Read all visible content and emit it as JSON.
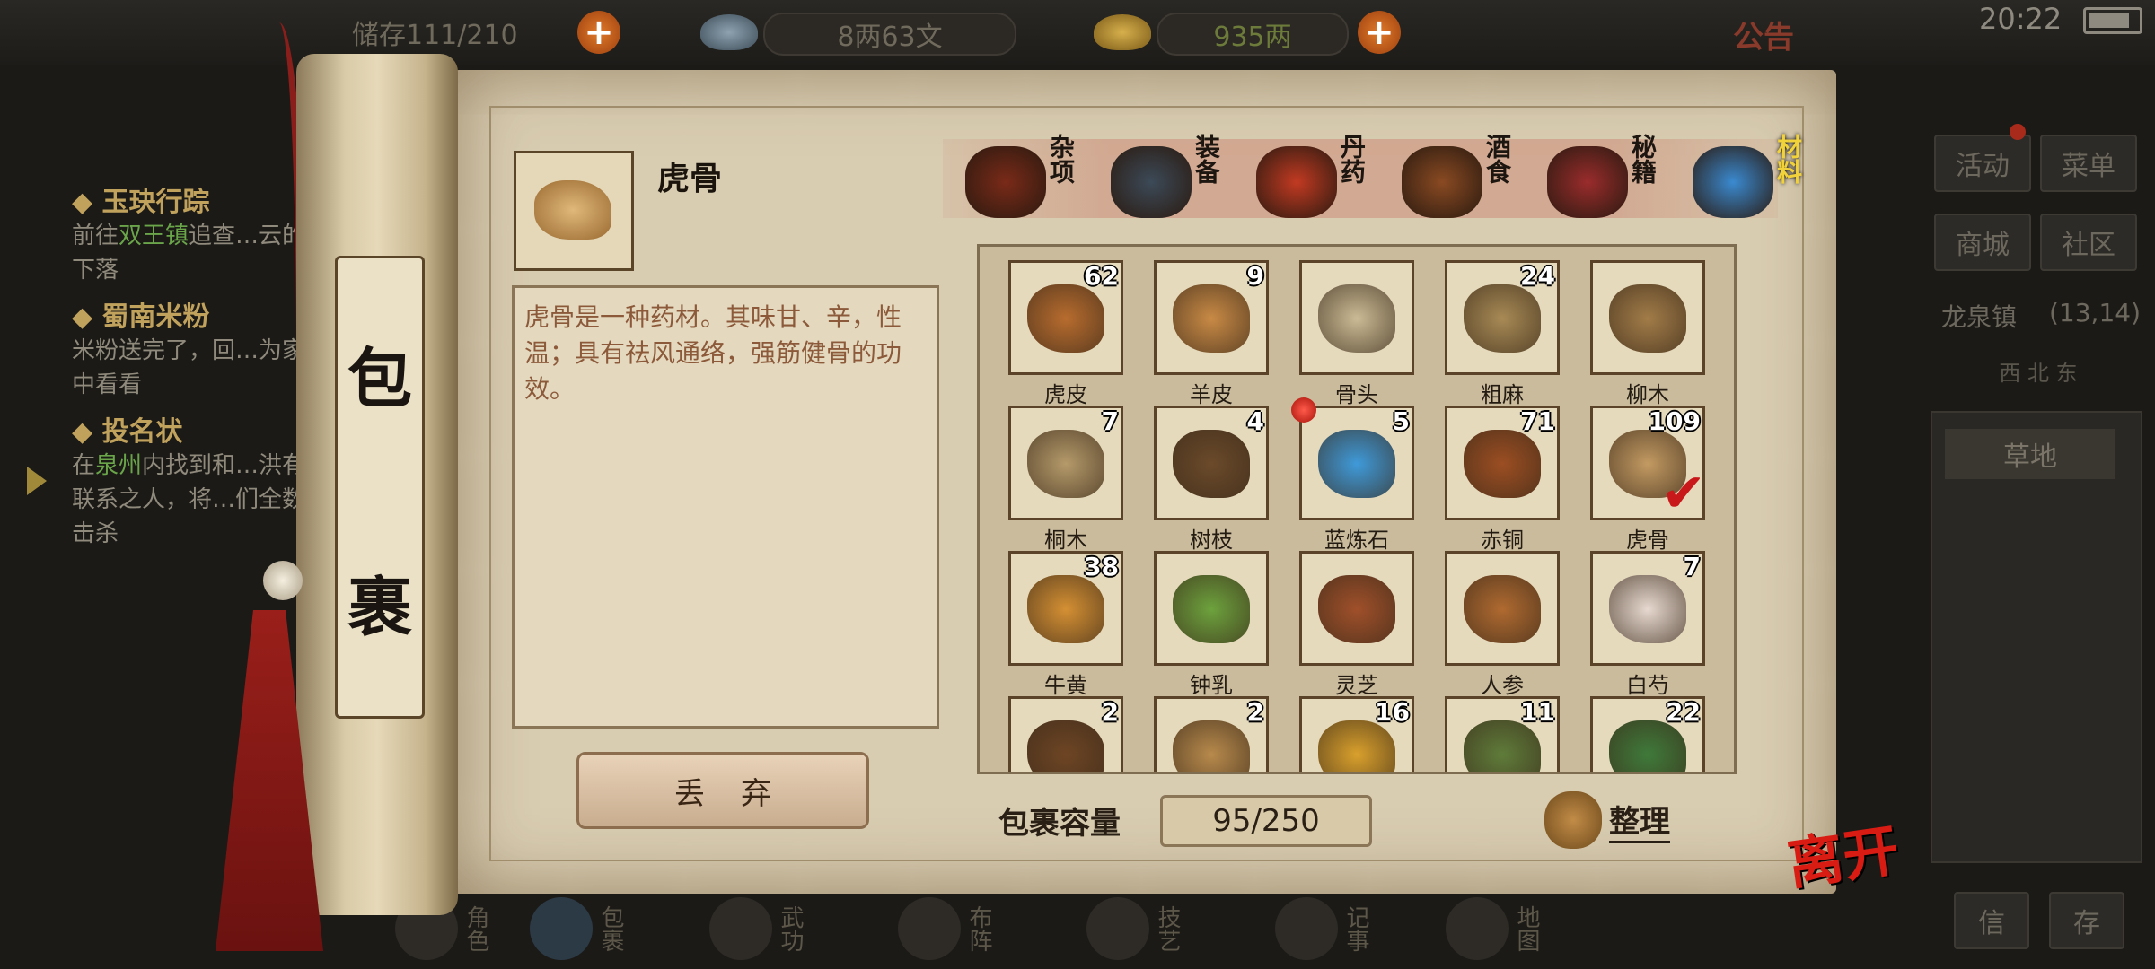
{
  "status": {
    "time": "20:22"
  },
  "topbar": {
    "storage": "储存111/210",
    "silver": "8两63文",
    "gold": "935两",
    "notice": "公告"
  },
  "quests": [
    {
      "title": "玉玦行踪",
      "text_pre": "前往",
      "hl": "双王镇",
      "text_post": "追查…云的下落"
    },
    {
      "title": "蜀南米粉",
      "text_pre": "米粉送完了，回…为家中看看",
      "hl": "",
      "text_post": ""
    },
    {
      "title": "投名状",
      "text_pre": "在",
      "hl": "泉州",
      "text_post": "内找到和…洪有联系之人，将…们全数击杀"
    }
  ],
  "right_panel": {
    "buttons": [
      "活动",
      "菜单",
      "商城",
      "社区"
    ],
    "location": "龙泉镇",
    "coords": "(13,14)",
    "compass": "西 北 东",
    "terrain": "草地",
    "bottom_buttons": [
      "信",
      "存"
    ]
  },
  "scroll_title": [
    "包",
    "裹"
  ],
  "selected": {
    "name": "虎骨",
    "description": "虎骨是一种药材。其味甘、辛，性温；具有祛风通络，强筋健骨的功效。"
  },
  "discard_label": "丢弃",
  "tabs": [
    {
      "label": "杂项",
      "icon": "jar-icon",
      "color": "#7a2a18"
    },
    {
      "label": "装备",
      "icon": "armor-icon",
      "color": "#3c4a58"
    },
    {
      "label": "丹药",
      "icon": "pill-icon",
      "color": "#c23a22"
    },
    {
      "label": "酒食",
      "icon": "food-icon",
      "color": "#8a4a22"
    },
    {
      "label": "秘籍",
      "icon": "book-icon",
      "color": "#9a2c2c"
    },
    {
      "label": "材料",
      "icon": "crystal-icon",
      "color": "#3a8ad0"
    }
  ],
  "active_tab": "材料",
  "items": [
    {
      "name": "虎皮",
      "count": "62",
      "color": "#b86c2e"
    },
    {
      "name": "羊皮",
      "count": "9",
      "color": "#c98a45"
    },
    {
      "name": "骨头",
      "count": "",
      "color": "#cbbb95"
    },
    {
      "name": "粗麻",
      "count": "24",
      "color": "#a88a55"
    },
    {
      "name": "柳木",
      "count": "",
      "color": "#a27c48"
    },
    {
      "name": "桐木",
      "count": "7",
      "color": "#b59a6a"
    },
    {
      "name": "树枝",
      "count": "4",
      "color": "#6b4a2a"
    },
    {
      "name": "蓝炼石",
      "count": "5",
      "color": "#3f9ad9"
    },
    {
      "name": "赤铜",
      "count": "71",
      "color": "#9c4e22"
    },
    {
      "name": "虎骨",
      "count": "109",
      "color": "#c39a62"
    },
    {
      "name": "牛黄",
      "count": "38",
      "color": "#d59033"
    },
    {
      "name": "钟乳",
      "count": "",
      "color": "#6da23d"
    },
    {
      "name": "灵芝",
      "count": "",
      "color": "#a0502a"
    },
    {
      "name": "人参",
      "count": "",
      "color": "#b06a30"
    },
    {
      "name": "白芍",
      "count": "7",
      "color": "#e8d9d0"
    },
    {
      "name": "",
      "count": "2",
      "color": "#6e4524"
    },
    {
      "name": "",
      "count": "2",
      "color": "#b88a4c"
    },
    {
      "name": "",
      "count": "16",
      "color": "#d9a02c"
    },
    {
      "name": "",
      "count": "11",
      "color": "#5f7c3a"
    },
    {
      "name": "",
      "count": "22",
      "color": "#3f7a3a"
    }
  ],
  "selected_index": 9,
  "new_badge_index": 7,
  "capacity": {
    "label": "包裹容量",
    "value": "95/250"
  },
  "sort_label": "整理",
  "leave_label": "离开",
  "bottom_nav": [
    "角色",
    "包裹",
    "武功",
    "布阵",
    "技艺",
    "记事",
    "地图"
  ]
}
